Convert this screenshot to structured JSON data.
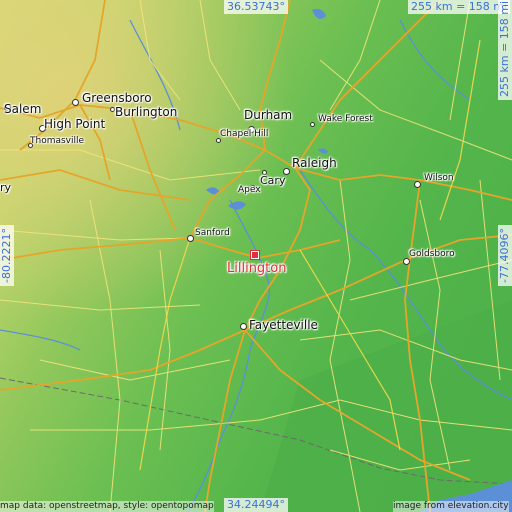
{
  "map": {
    "focus_city": "Lillington",
    "cities": {
      "salem": "Salem",
      "greensboro": "Greensboro",
      "burlington": "Burlington",
      "high_point": "High Point",
      "thomasville": "Thomasville",
      "durham": "Durham",
      "chapel_hill": "Chapel Hill",
      "wake_forest": "Wake Forest",
      "raleigh": "Raleigh",
      "cary": "Cary",
      "apex": "Apex",
      "wilson": "Wilson",
      "sanford": "Sanford",
      "goldsboro": "Goldsboro",
      "fayetteville": "Fayetteville",
      "edge_fragment": "ry"
    },
    "coords": {
      "north": "36.53743°",
      "south": "34.24494°",
      "west": "-80.2221°",
      "east": "-77.4096°"
    },
    "scale_horizontal": "255 km = 158 mi",
    "scale_vertical": "255 km = 158 mi",
    "attribution_left": "map data: openstreetmap, style: opentopomap",
    "attribution_right": "image from elevation.city"
  },
  "colors": {
    "lowland": "#58b94e",
    "upland": "#c8d86a",
    "coord_text": "#3d6fd6",
    "focus_marker": "#e0303b",
    "road_major": "#e6a823",
    "road_minor": "#f4e36a",
    "water": "#5b8fd6"
  }
}
